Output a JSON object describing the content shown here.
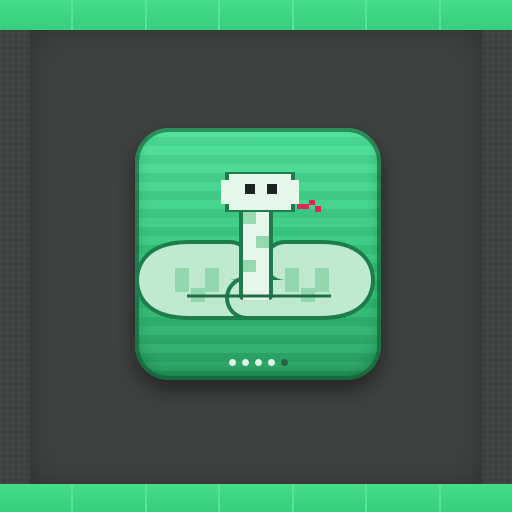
{
  "icon": {
    "name": "snake-app-icon",
    "colors": {
      "accent": "#3fd985",
      "icon_top": "#4fe39b",
      "icon_bottom": "#2aa565",
      "snake_light": "#e7f7ec",
      "snake_mid": "#9fdcb7",
      "tongue": "#e0245e",
      "background": "#3f4241"
    },
    "page_indicator": {
      "count": 5,
      "active_count": 4
    }
  }
}
